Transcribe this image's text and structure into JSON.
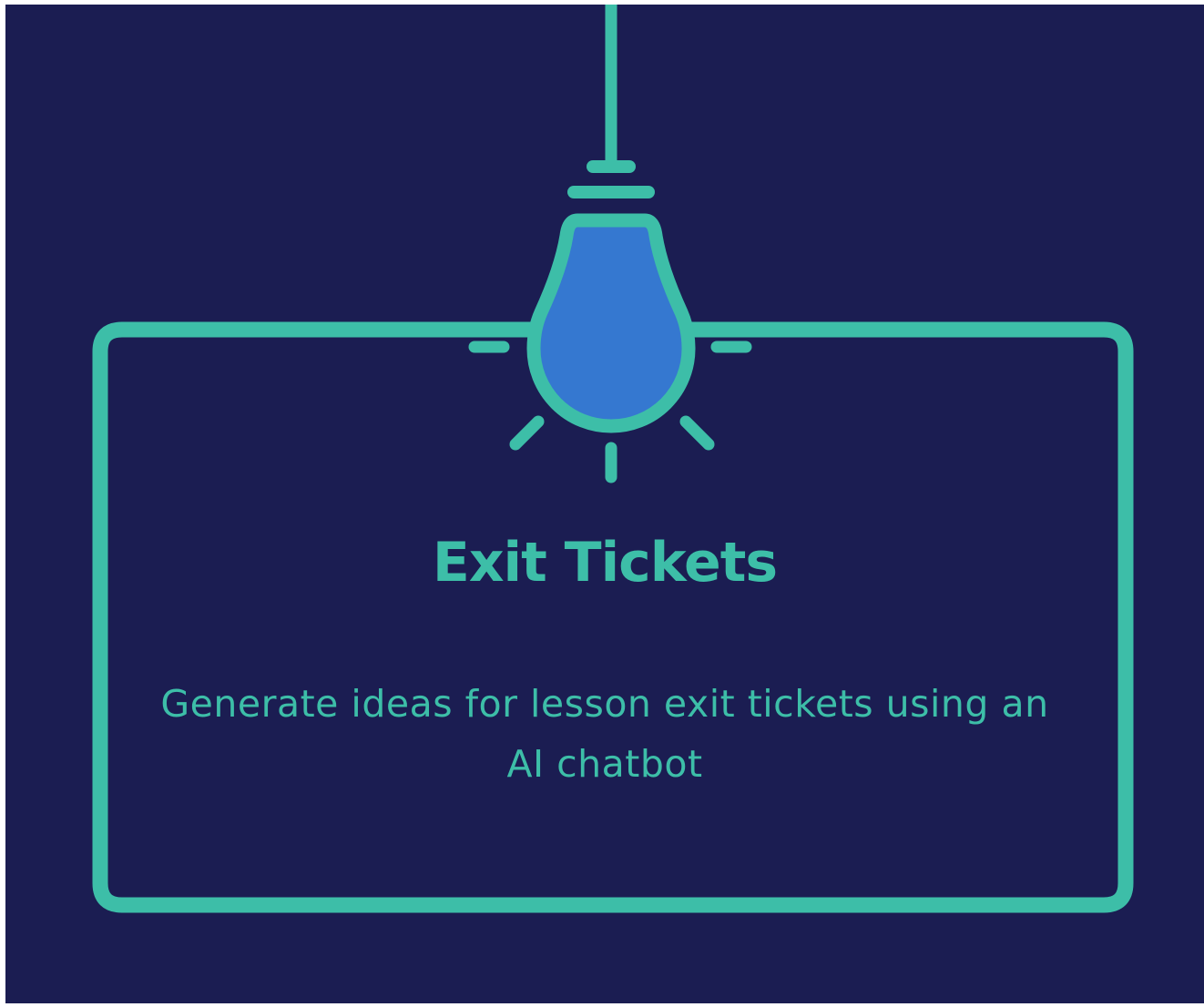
{
  "card": {
    "title": "Exit Tickets",
    "description": "Generate ideas for lesson exit tickets using an AI chatbot"
  },
  "colors": {
    "background": "#1b1d52",
    "accent": "#3dbea8",
    "bulb_fill": "#3578d0"
  },
  "icons": {
    "bulb": "lightbulb-icon",
    "rays": "light-rays-icon"
  }
}
